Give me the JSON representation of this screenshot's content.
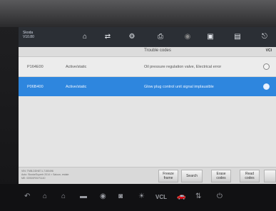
{
  "header": {
    "brand_line1": "Skoda",
    "brand_line2": "V10.80"
  },
  "toolbar_icons": [
    "home-icon",
    "vehicle-swap-icon",
    "settings-icon",
    "print-icon",
    "help-icon",
    "screenshot-icon",
    "save-icon",
    "exit-icon"
  ],
  "title": "Trouble codes",
  "vcs_label": "VCI",
  "rows": [
    {
      "code": "P164E00",
      "status": "Active/static",
      "description": "Oil pressure regulation valve, Electrical error",
      "selected": false
    },
    {
      "code": "P06B400",
      "status": "Active/static",
      "description": "Glow plug control unit signal implausible",
      "selected": true
    }
  ],
  "vehicle_info": {
    "line1": "VIN: TMB-DDNE7-L7150496",
    "line2": "Auto: Skoda/Superb 2014 > Saloon, estate",
    "line3": "ME: 03S00R01F1140"
  },
  "buttons": {
    "freeze_frame": "Freeze frame",
    "search": "Search",
    "erase_codes": "Erase codes",
    "read_codes": "Read codes"
  },
  "nav_icons": [
    "back-icon",
    "home-icon",
    "house-icon",
    "recent-apps-icon",
    "browser-icon",
    "camera-icon",
    "brightness-icon",
    "vci-icon",
    "car-icon",
    "network-icon",
    "power-icon"
  ],
  "nav_vcl": "VCL",
  "colors": {
    "header_bg": "#2b2f35",
    "selected_row": "#2e86de",
    "screen_bg": "#e6e6e6"
  }
}
